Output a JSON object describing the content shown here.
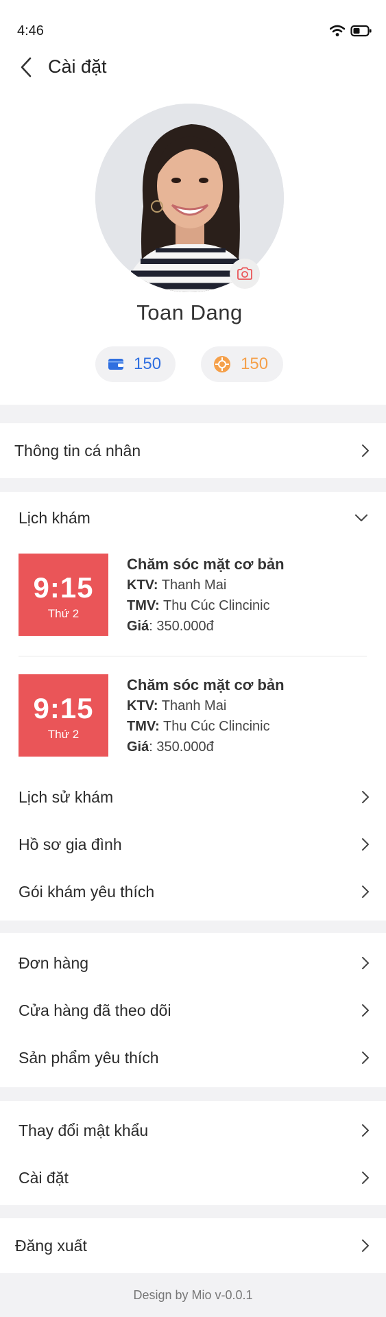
{
  "status_bar": {
    "time": "4:46"
  },
  "header": {
    "title": "Cài đặt"
  },
  "profile": {
    "name": "Toan Dang",
    "wallet_value": "150",
    "coin_value": "150"
  },
  "personal_info": {
    "label": "Thông tin cá nhân"
  },
  "schedule": {
    "label": "Lịch khám",
    "appointments": [
      {
        "time": "9:15",
        "day": "Thứ 2",
        "title": "Chăm sóc mặt cơ bản",
        "ktv_label": "KTV:",
        "ktv_value": "Thanh Mai",
        "tmv_label": "TMV:",
        "tmv_value": "Thu Cúc Clincinic",
        "price_label": "Giá",
        "price_value": ": 350.000đ"
      },
      {
        "time": "9:15",
        "day": "Thứ 2",
        "title": "Chăm sóc mặt cơ bản",
        "ktv_label": "KTV:",
        "ktv_value": "Thanh Mai",
        "tmv_label": "TMV:",
        "tmv_value": "Thu Cúc Clincinic",
        "price_label": "Giá",
        "price_value": ": 350.000đ"
      }
    ],
    "history": "Lịch sử khám",
    "family": "Hồ sơ gia đình",
    "favorite_packages": "Gói khám yêu thích"
  },
  "shopping": {
    "orders": "Đơn hàng",
    "followed_stores": "Cửa hàng đã theo dõi",
    "favorite_products": "Sản phẩm yêu thích"
  },
  "account": {
    "change_password": "Thay đổi mật khẩu",
    "settings": "Cài đặt"
  },
  "logout": {
    "label": "Đăng xuất"
  },
  "footer": {
    "text": "Design by Mio v-0.0.1"
  },
  "colors": {
    "accent_red": "#ea5558",
    "wallet_blue": "#2f6fe0",
    "coin_orange": "#f5a04a",
    "background": "#f2f2f4"
  }
}
